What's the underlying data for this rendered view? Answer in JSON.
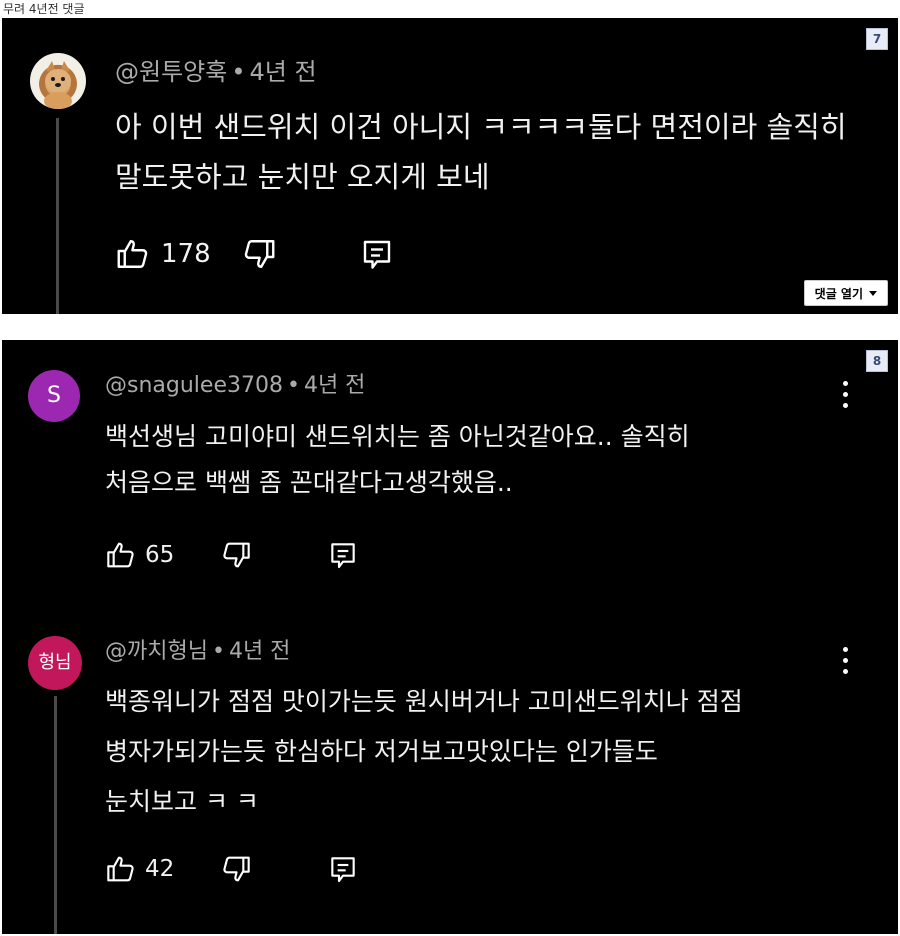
{
  "page_caption": "무려 4년전 댓글",
  "colors": {
    "background": "#000000",
    "text": "#f1f1f1",
    "meta": "#aaaaaa",
    "avatar_s": "#9c27b0",
    "avatar_hyeongnim": "#c2185b"
  },
  "comments": [
    {
      "page_number": "7",
      "author": "@원투양훅",
      "time": "4년 전",
      "avatar_icon": "dog-photo-avatar",
      "lines": [
        "아 이번 샌드위치 이건 아니지 ㅋㅋㅋㅋ둘다 면전이라 솔직히",
        "말도못하고 눈치만 오지게 보네"
      ],
      "likes": "178",
      "reply_toggle": "댓글 열기"
    },
    {
      "page_number": "8",
      "author": "@snagulee3708",
      "time": "4년 전",
      "avatar_letter": "S",
      "lines": [
        "백선생님 고미야미 샌드위치는 좀 아닌것같아요.. 솔직히",
        "처음으로 백쌤 좀 꼰대같다고생각했음.."
      ],
      "likes": "65"
    },
    {
      "author": "@까치형님",
      "time": "4년 전",
      "avatar_letter": "형님",
      "lines": [
        "백종워니가 점점 맛이가는듯 원시버거나  고미샌드위치나 점점",
        "병자가되가는듯 한심하다 저거보고맛있다는 인가들도",
        "눈치보고 ㅋ ㅋ"
      ],
      "likes": "42"
    }
  ]
}
